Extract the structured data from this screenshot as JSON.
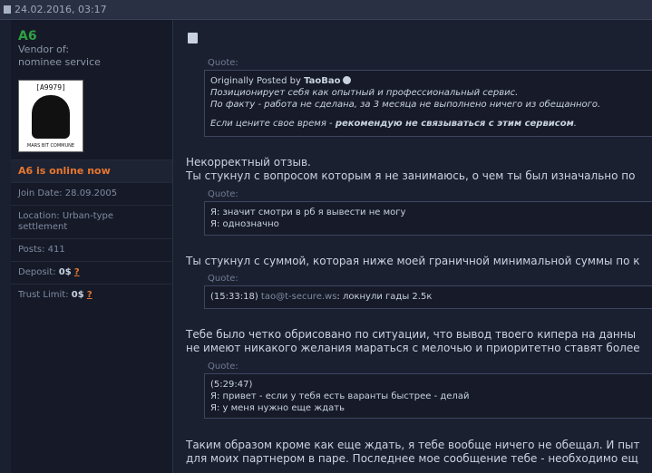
{
  "topbar": {
    "date": "24.02.2016, 03:17"
  },
  "sidebar": {
    "username": "A6",
    "vendor_line1": "Vendor of:",
    "vendor_line2": "nominee service",
    "avatar_label": "[A9979]",
    "avatar_footer": "MARS BIT COMMUNE",
    "online": "A6 is online now",
    "join_date": "Join Date: 28.09.2005",
    "location": "Location: Urban-type settlement",
    "posts": "Posts: 411",
    "deposit_label": "Deposit: ",
    "deposit_value": "0$",
    "deposit_help": "?",
    "trust_label": "Trust Limit: ",
    "trust_value": "0$",
    "trust_help": "?"
  },
  "post": {
    "quote_label": "Quote:",
    "q1": {
      "prefix": "Originally Posted by ",
      "author": "TaoBao",
      "line1": "Позиционирует себя как опытный и профессиональный сервис.",
      "line2": "По факту - работа не сделана, за 3 месяца не выполнено ничего из обещанного.",
      "line3_pre": "Если цените свое время - ",
      "line3_bold": "рекомендую не связываться с этим сервисом",
      "line3_post": "."
    },
    "p1_line1": "Некорректный отзыв.",
    "p1_line2": "Ты стукнул с вопросом которым я не занимаюсь, о чем ты был изначально по",
    "q2": {
      "line1": "Я: значит смотри в рб я вывести не могу",
      "line2": "Я: однозначно"
    },
    "p2_line1": "Ты стукнул с суммой, которая ниже моей граничной минимальной суммы по к",
    "q3": {
      "time": "(15:33:18) ",
      "email": "tao@t-secure.ws",
      "text": ": локнули гады 2.5к"
    },
    "p3_line1": "Тебе было четко обрисовано по ситуации, что вывод твоего кипера на данны",
    "p3_line2": "не имеют никакого желания мараться с мелочью и приоритетно ставят более",
    "q4": {
      "line1": "(5:29:47)",
      "line2": "Я: привет - если у тебя есть варанты быстрее - делай",
      "line3": "Я: у меня нужно еще ждать"
    },
    "p4_line1": "Таким образом кроме как еще ждать, я тебе вообще ничего не обещал. И пыт",
    "p4_line2": "для моих партнером в паре. Последнее мое сообщение тебе - необходимо ещ"
  }
}
